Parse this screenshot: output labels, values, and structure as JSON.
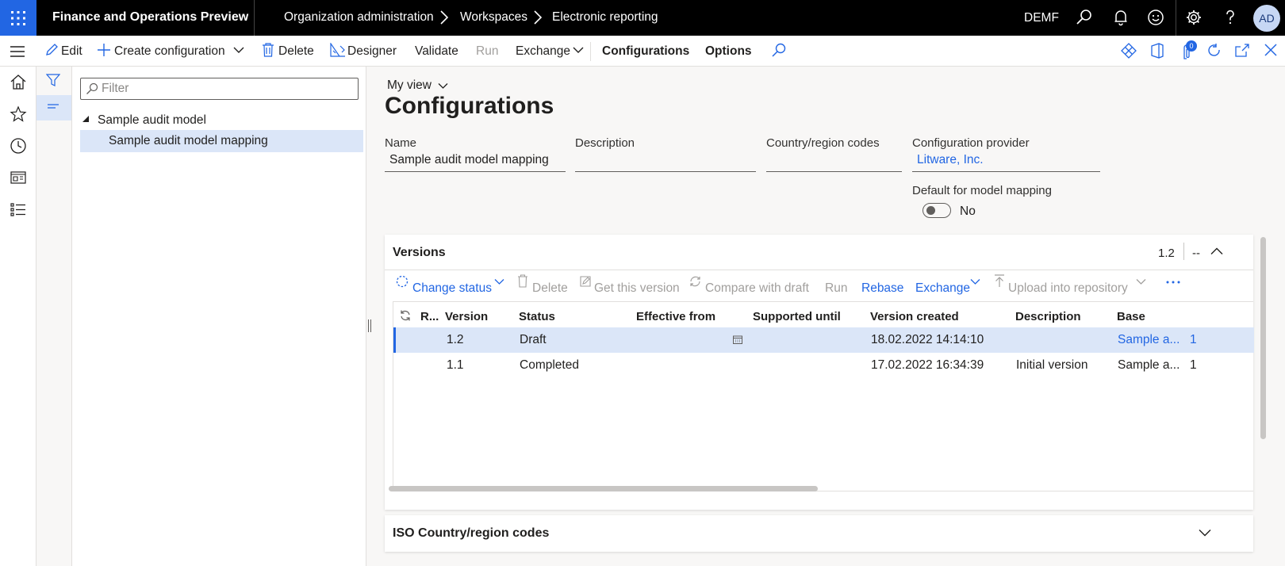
{
  "topbar": {
    "app_title": "Finance and Operations Preview",
    "breadcrumbs": [
      "Organization administration",
      "Workspaces",
      "Electronic reporting"
    ],
    "company": "DEMF",
    "avatar_initials": "AD",
    "waffle_color": "#2266e3"
  },
  "actionpane": {
    "edit": "Edit",
    "create_configuration": "Create configuration",
    "delete": "Delete",
    "designer": "Designer",
    "validate": "Validate",
    "run": "Run",
    "exchange": "Exchange",
    "configurations": "Configurations",
    "options": "Options",
    "attachments_count": "0"
  },
  "tree": {
    "filter_placeholder": "Filter",
    "root": "Sample audit model",
    "child": "Sample audit model mapping"
  },
  "page": {
    "view_name": "My view",
    "title": "Configurations"
  },
  "fields": {
    "name_label": "Name",
    "name_value": "Sample audit model mapping",
    "description_label": "Description",
    "description_value": "",
    "country_label": "Country/region codes",
    "country_value": "",
    "provider_label": "Configuration provider",
    "provider_value": "Litware, Inc.",
    "default_mapping_label": "Default for model mapping",
    "default_mapping_value": "No"
  },
  "versions": {
    "title": "Versions",
    "summary_version": "1.2",
    "summary_extra": "--",
    "toolbar": {
      "change_status": "Change status",
      "delete": "Delete",
      "get_this_version": "Get this version",
      "compare_with_draft": "Compare with draft",
      "run": "Run",
      "rebase": "Rebase",
      "exchange": "Exchange",
      "upload_into_repository": "Upload into repository"
    },
    "columns": [
      "R...",
      "Version",
      "Status",
      "Effective from",
      "Supported until",
      "Version created",
      "Description",
      "Base"
    ],
    "rows": [
      {
        "version": "1.2",
        "status": "Draft",
        "effective_from": "",
        "supported_until": "",
        "created": "18.02.2022 14:14:10",
        "description": "",
        "base": "Sample a...",
        "base_version": "1"
      },
      {
        "version": "1.1",
        "status": "Completed",
        "effective_from": "",
        "supported_until": "",
        "created": "17.02.2022 16:34:39",
        "description": "Initial version",
        "base": "Sample a...",
        "base_version": "1"
      }
    ]
  },
  "iso_panel": {
    "title": "ISO Country/region codes"
  }
}
